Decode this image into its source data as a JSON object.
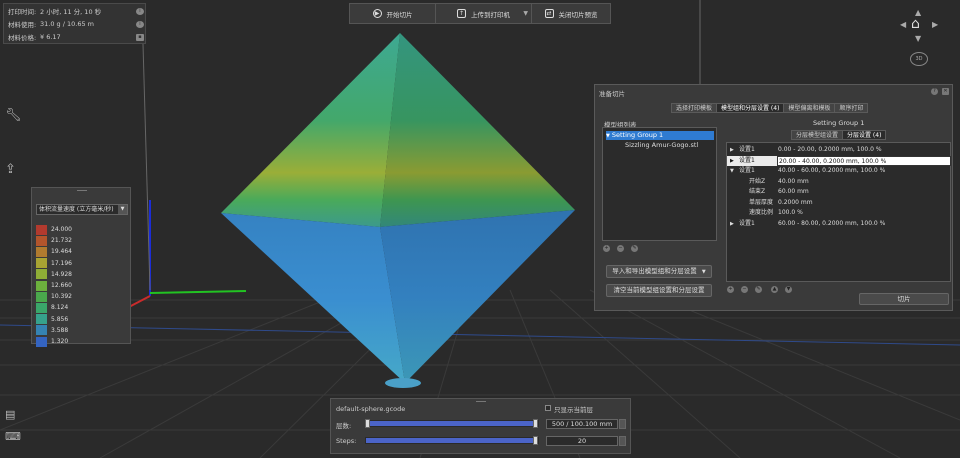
{
  "print_info": {
    "rows": [
      {
        "label": "打印时间:",
        "value": "2 小时, 11 分, 10 秒"
      },
      {
        "label": "材料使用:",
        "value": "31.0 g / 10.65 m"
      },
      {
        "label": "材料价格:",
        "value": "¥ 6.17"
      }
    ],
    "info_icon": "info-icon",
    "save_icon": "save-icon"
  },
  "toolbar": {
    "start_slice": "开始切片",
    "upload_to_printer": "上传到打印机",
    "close_preview": "关闭切片预览"
  },
  "legend": {
    "dropdown_value": "体积流量速度 (立方毫米/秒)",
    "entries": [
      {
        "value": "24.000",
        "color": "#b23a2e"
      },
      {
        "value": "21.732",
        "color": "#b3552c"
      },
      {
        "value": "19.464",
        "color": "#b07b2f"
      },
      {
        "value": "17.196",
        "color": "#a8a433"
      },
      {
        "value": "14.928",
        "color": "#8fad36"
      },
      {
        "value": "12.660",
        "color": "#6cb03d"
      },
      {
        "value": "10.392",
        "color": "#4aa84c"
      },
      {
        "value": "8.124",
        "color": "#3aa66a"
      },
      {
        "value": "5.856",
        "color": "#36a28c"
      },
      {
        "value": "3.588",
        "color": "#3583b3"
      },
      {
        "value": "1.320",
        "color": "#3464c1"
      }
    ]
  },
  "slicing_dialog": {
    "title": "准备切片",
    "tabs": [
      "选择打印模板",
      "模型组和分层设置 (4)",
      "模型偏离和模板",
      "顺序打印"
    ],
    "active_tab": 1,
    "model_group_label": "模型组列表",
    "tree": [
      "Setting Group 1",
      "Sizzling Amur-Gogo.stl"
    ],
    "group_header": "Setting Group 1",
    "sub_tabs": [
      "分层模型组设置",
      "分层设置 (4)"
    ],
    "layer_rows": [
      {
        "k": "设置1",
        "v": "0.00 - 20.00, 0.2000 mm, 100.0 %",
        "indent": 0,
        "highlight": false
      },
      {
        "k": "设置1",
        "v": "20.00 - 40.00, 0.2000 mm, 100.0 %",
        "indent": 0,
        "highlight": true
      },
      {
        "k": "设置1",
        "v": "40.00 - 60.00, 0.2000 mm, 100.0 %",
        "indent": 0,
        "highlight": false
      },
      {
        "k": "开始Z",
        "v": "40.00 mm",
        "indent": 1,
        "highlight": false
      },
      {
        "k": "结束Z",
        "v": "60.00 mm",
        "indent": 1,
        "highlight": false
      },
      {
        "k": "单层厚度",
        "v": "0.2000 mm",
        "indent": 1,
        "highlight": false
      },
      {
        "k": "速度比例",
        "v": "100.0 %",
        "indent": 1,
        "highlight": false
      },
      {
        "k": "设置1",
        "v": "60.00 - 80.00, 0.2000 mm, 100.0 %",
        "indent": 0,
        "highlight": false
      }
    ],
    "import_export": "导入和导出模型组和分层设置",
    "clear_button": "清空当前模型组设置和分层设置",
    "slice_button": "切片"
  },
  "gcode": {
    "filename": "default-sphere.gcode",
    "show_current_layer": "只显示当前层",
    "layers_label": "层数:",
    "layers_value": "500 / 100.100 mm",
    "steps_label": "Steps:",
    "steps_value": "20",
    "layers_fraction": 1.0,
    "steps_fraction": 1.0
  },
  "nav": {
    "home_icon": "home-icon",
    "rotate_label": "3D"
  }
}
